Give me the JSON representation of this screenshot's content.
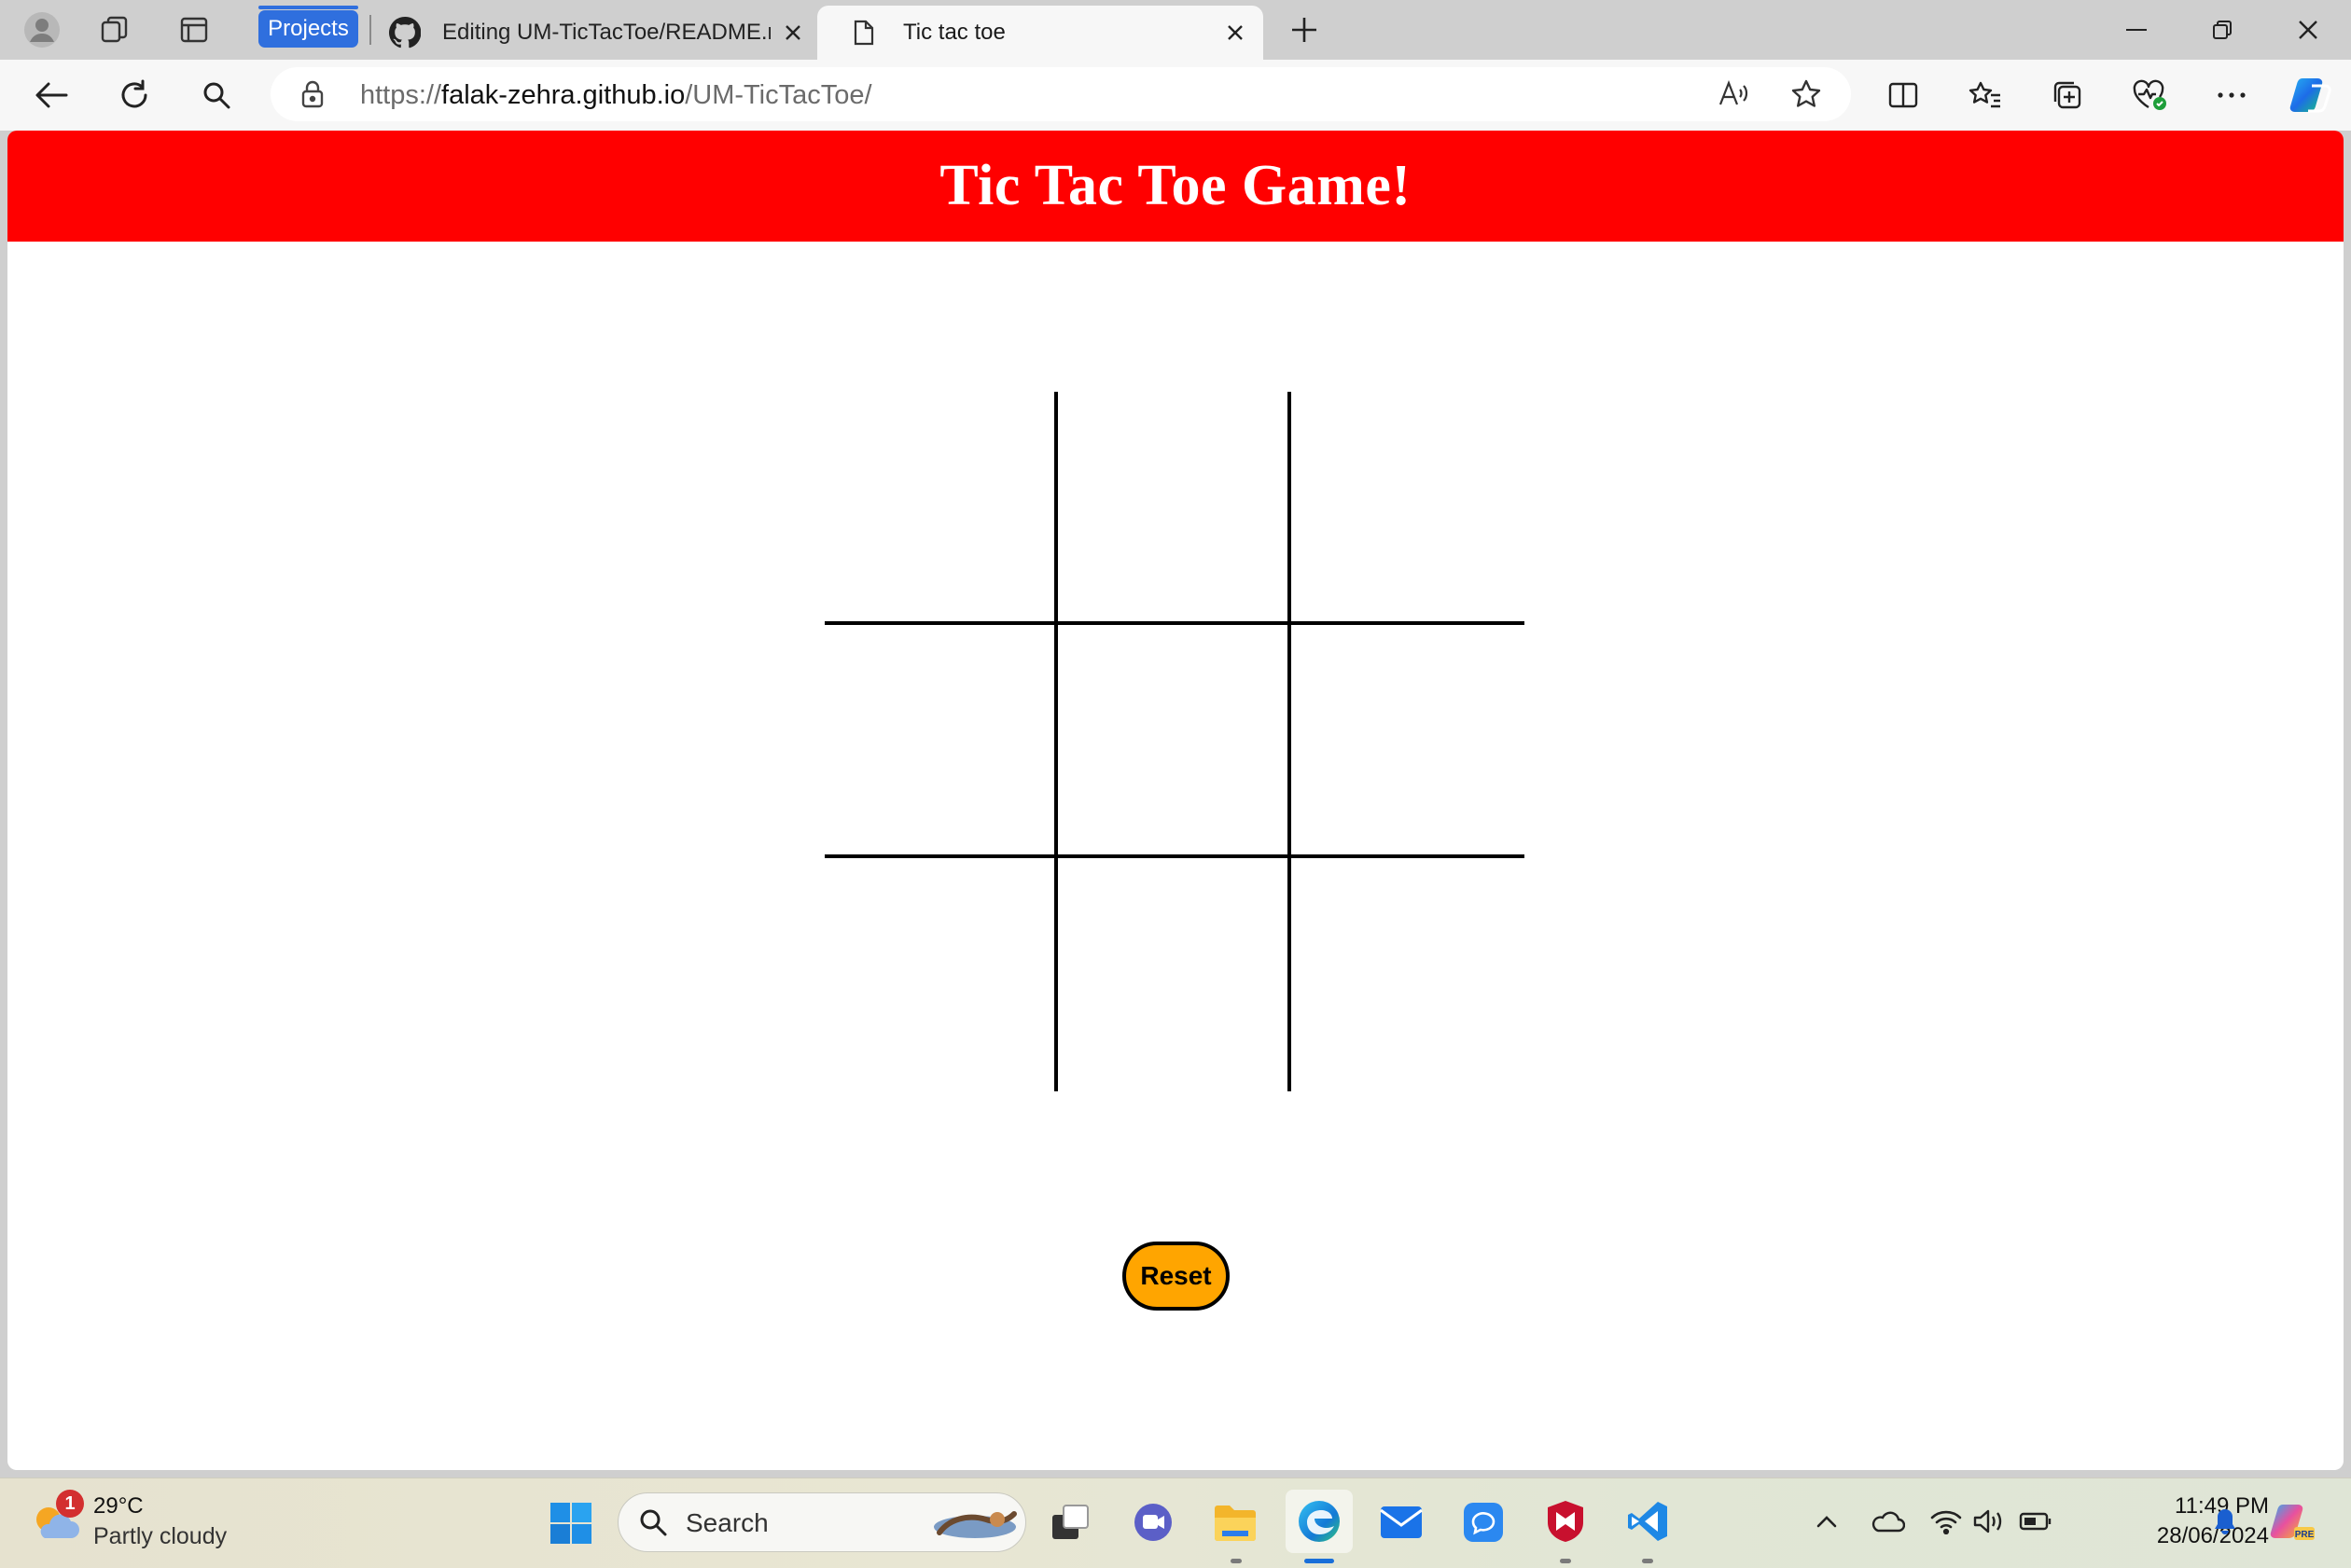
{
  "browser": {
    "tabs": [
      {
        "label": "Editing UM-TicTacToe/README.md",
        "active": false
      },
      {
        "label": "Tic tac toe",
        "active": true
      }
    ],
    "tab_group": "Projects",
    "url": {
      "scheme": "https://",
      "host": "falak-zehra.github.io",
      "path": "/UM-TicTacToe/"
    },
    "accent": "#2f6fde"
  },
  "page": {
    "title": "Tic Tac Toe Game!",
    "header_color": "#ff0000",
    "board": {
      "cells": [
        "",
        "",
        "",
        "",
        "",
        "",
        "",
        "",
        ""
      ]
    },
    "reset_label": "Reset",
    "reset_color": "#ffa500"
  },
  "taskbar": {
    "weather": {
      "temp": "29°C",
      "desc": "Partly cloudy",
      "badge": "1"
    },
    "search_placeholder": "Search",
    "clock": {
      "time": "11:49 PM",
      "date": "28/06/2024"
    },
    "apps": [
      "start-icon",
      "search-icon",
      "task-view-icon",
      "teams-icon",
      "file-explorer-icon",
      "edge-icon",
      "mail-icon",
      "chat-icon",
      "mcafee-icon",
      "vscode-icon"
    ],
    "tray": [
      "chevron-up-icon",
      "onedrive-icon",
      "wifi-icon",
      "volume-icon",
      "battery-icon",
      "notification-bell-icon",
      "copilot-icon"
    ]
  }
}
